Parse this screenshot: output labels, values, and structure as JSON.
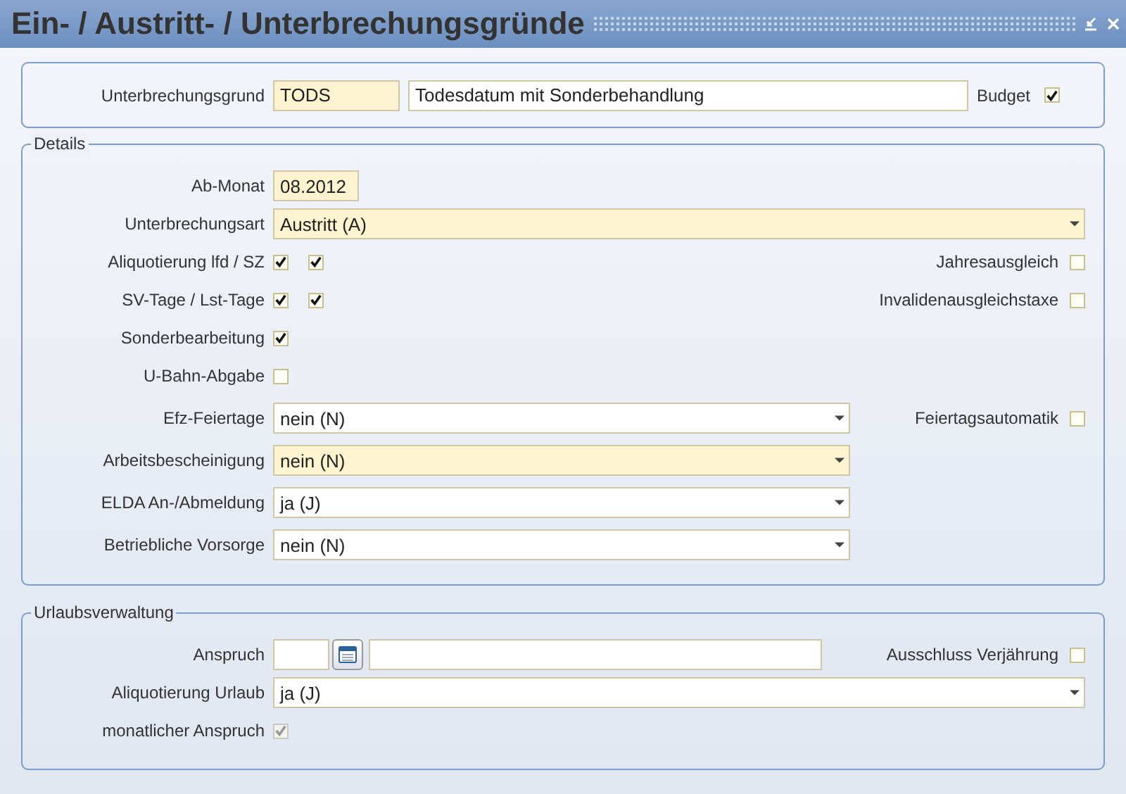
{
  "window": {
    "title": "Ein- / Austritt- / Unterbrechungsgründe"
  },
  "header": {
    "label": "Unterbrechungsgrund",
    "code": {
      "value": "TODS",
      "required": true
    },
    "description": {
      "value": "Todesdatum mit Sonderbehandlung",
      "required": false
    },
    "budget": {
      "label": "Budget",
      "checked": true,
      "disabled": false
    }
  },
  "details": {
    "legend": "Details",
    "month": {
      "label": "Ab-Monat",
      "value": "08.2012",
      "required": true
    },
    "type": {
      "label": "Unterbrechungsart",
      "value": "Austritt (A)",
      "required": true
    },
    "flags": [
      {
        "label": "Aliquotierung lfd / SZ",
        "checks": [
          {
            "checked": true,
            "disabled": false
          },
          {
            "checked": true,
            "disabled": false
          }
        ],
        "side": {
          "label": "Jahresausgleich",
          "checked": false,
          "disabled": false
        }
      },
      {
        "label": "SV-Tage / Lst-Tage",
        "checks": [
          {
            "checked": true,
            "disabled": false
          },
          {
            "checked": true,
            "disabled": false
          }
        ],
        "side": {
          "label": "Invalidenausgleichstaxe",
          "checked": false,
          "disabled": false
        }
      },
      {
        "label": "Sonderbearbeitung",
        "checks": [
          {
            "checked": true,
            "disabled": false
          }
        ]
      },
      {
        "label": "U-Bahn-Abgabe",
        "checks": [
          {
            "checked": false,
            "disabled": false
          }
        ]
      }
    ],
    "selects": [
      {
        "label": "Efz-Feiertage",
        "value": "nein (N)",
        "required": false,
        "side": {
          "label": "Feiertagsautomatik",
          "checked": false,
          "disabled": false
        }
      },
      {
        "label": "Arbeitsbescheinigung",
        "value": "nein (N)",
        "required": true
      },
      {
        "label": "ELDA An-/Abmeldung",
        "value": "ja (J)",
        "required": false
      },
      {
        "label": "Betriebliche Vorsorge",
        "value": "nein (N)",
        "required": false
      }
    ]
  },
  "vacation": {
    "legend": "Urlaubsverwaltung",
    "claim": {
      "label": "Anspruch",
      "side": {
        "label": "Ausschluss Verjährung",
        "checked": false,
        "disabled": false
      }
    },
    "prorate": {
      "label": "Aliquotierung Urlaub",
      "value": "ja (J)",
      "required": false
    },
    "monthly": {
      "label": "monatlicher Anspruch",
      "checked": true,
      "disabled": true
    }
  }
}
